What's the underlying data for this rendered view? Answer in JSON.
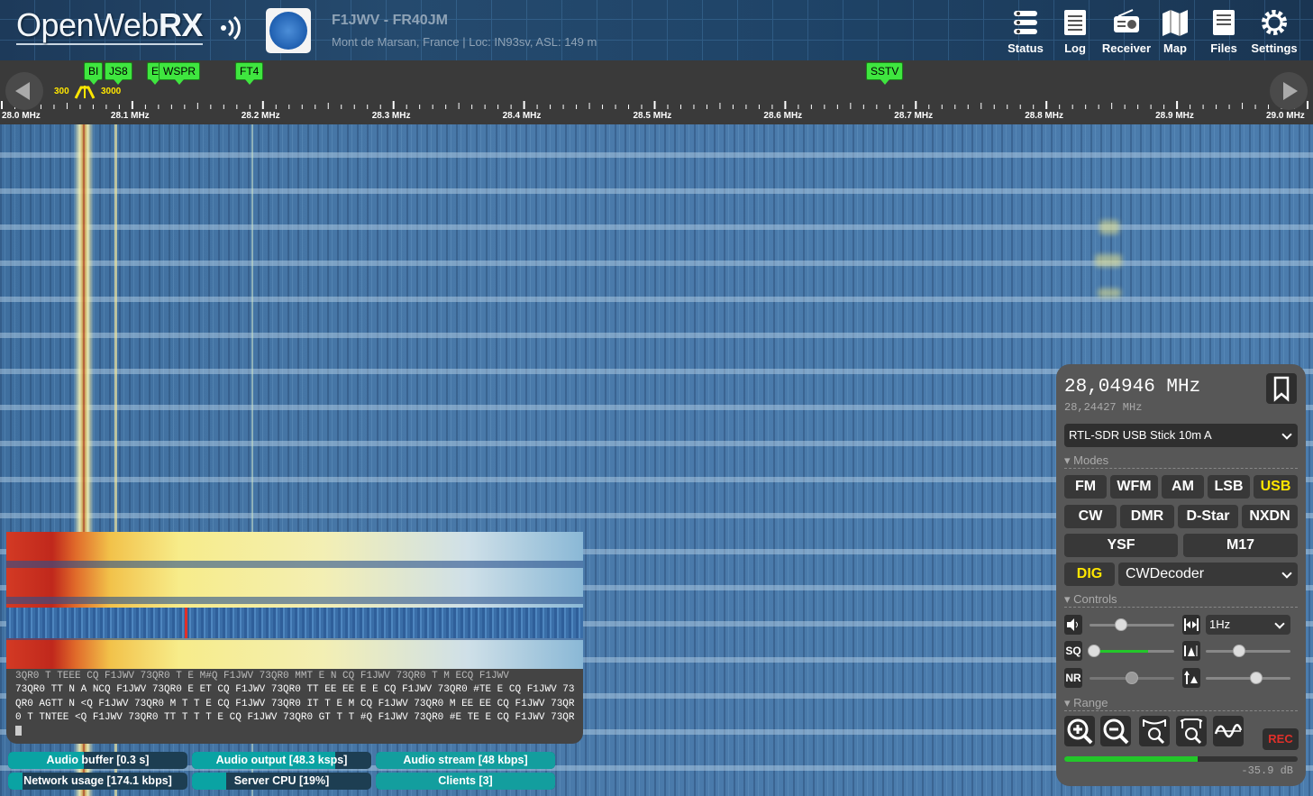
{
  "header": {
    "logo_text": "OpenWeb",
    "logo_bold": "RX",
    "receiver_title": "F1JWV - FR40JM",
    "receiver_desc": "Mont de Marsan, France | Loc: IN93sv, ASL: 149 m",
    "buttons": [
      {
        "label": "Status",
        "icon": "status-icon"
      },
      {
        "label": "Log",
        "icon": "log-icon"
      },
      {
        "label": "Receiver",
        "icon": "receiver-icon"
      },
      {
        "label": "Map",
        "icon": "map-icon"
      },
      {
        "label": "Files",
        "icon": "files-icon"
      },
      {
        "label": "Settings",
        "icon": "gear-icon"
      }
    ]
  },
  "scale": {
    "bookmarks": [
      "BI",
      "JS8",
      "E",
      "WSPR",
      "FT4",
      "SSTV"
    ],
    "bandwidth_low": "300",
    "bandwidth_high": "3000",
    "labels": [
      "28.0 MHz",
      "28.1 MHz",
      "28.2 MHz",
      "28.3 MHz",
      "28.4 MHz",
      "28.5 MHz",
      "28.6 MHz",
      "28.7 MHz",
      "28.8 MHz",
      "28.9 MHz",
      "29.0 MHz"
    ]
  },
  "cw_decoder": {
    "faded_line": "3QR0 T TEEE CQ F1JWV 73QR0 T E M#Q F1JWV 73QR0 MMT E N CQ F1JWV 73QR0 T M ECQ F1JWV",
    "text": "73QR0 TT N A NCQ F1JWV 73QR0 E ET CQ F1JWV 73QR0 TT EE EE E E CQ F1JWV 73QR0 #TE E CQ F1JWV 73QR0 AGTT N <Q F1JWV 73QR0 M T T E CQ F1JWV 73QR0 IT T E M CQ F1JWV 73QR0 M EE EE CQ F1JWV 73QR0 T TNTEE <Q F1JWV 73QR0 TT T T T E CQ F1JWV 73QR0 GT T T #Q F1JWV 73QR0 #E TE E CQ F1JWV 73QR"
  },
  "status": {
    "audio_buffer": "Audio buffer [0.3 s]",
    "audio_output": "Audio output [48.3 ksps]",
    "audio_stream": "Audio stream [48 kbps]",
    "network_usage": "Network usage [174.1 kbps]",
    "server_cpu": "Server CPU [19%]",
    "clients": "Clients [3]",
    "server_cpu_level": 0.19
  },
  "receiver": {
    "frequency": "28,04946 MHz",
    "offset_frequency": "28,24427 MHz",
    "profile": "RTL-SDR USB Stick 10m A",
    "modes_title": "Modes",
    "modes_row1": [
      "FM",
      "WFM",
      "AM",
      "LSB",
      "USB"
    ],
    "modes_row2": [
      "CW",
      "DMR",
      "D-Star",
      "NXDN"
    ],
    "modes_row3": [
      "YSF",
      "M17"
    ],
    "active_mode": "USB",
    "dig_label": "DIG",
    "decoder": "CWDecoder",
    "controls_title": "Controls",
    "step": "1Hz",
    "sq_label": "SQ",
    "nr_label": "NR",
    "range_title": "Range",
    "rec_label": "REC",
    "smeter_db": "-35.9 dB",
    "volume_level": 0.36,
    "squelch_level": 0.0,
    "nr_level": 0.5,
    "zoom_level": 0.5,
    "smeter_level": 0.57,
    "accent": "#ffe600",
    "meter_color": "#23c72a"
  }
}
